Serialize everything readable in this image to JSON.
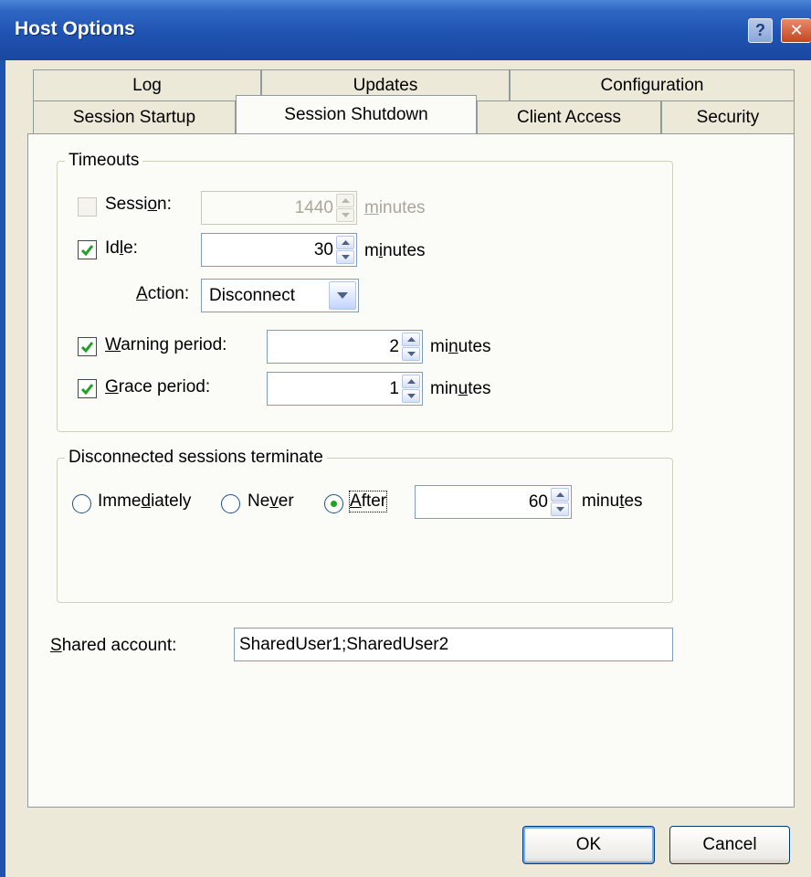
{
  "window": {
    "title": "Host Options",
    "help_glyph": "?",
    "close_glyph": "✕"
  },
  "tabs": {
    "row_top": [
      "Log",
      "Updates",
      "Configuration"
    ],
    "row_bottom": [
      "Session Startup",
      "Session Shutdown",
      "Client Access",
      "Security"
    ],
    "selected": "Session Shutdown"
  },
  "timeouts": {
    "group_label": "Timeouts",
    "session": {
      "label_pre": "Sessi",
      "label_mn": "o",
      "label_post": "n:",
      "checked": false,
      "value": "1440",
      "unit_pre": "",
      "unit_mn": "m",
      "unit_post": "inutes",
      "enabled": false
    },
    "idle": {
      "label_pre": "Id",
      "label_mn": "l",
      "label_post": "e:",
      "checked": true,
      "value": "30",
      "unit_pre": "m",
      "unit_mn": "i",
      "unit_post": "nutes",
      "enabled": true
    },
    "action": {
      "label_pre": "",
      "label_mn": "A",
      "label_post": "ction:",
      "value": "Disconnect"
    },
    "warning": {
      "label_pre": "",
      "label_mn": "W",
      "label_post": "arning period:",
      "checked": true,
      "value": "2",
      "unit_pre": "mi",
      "unit_mn": "n",
      "unit_post": "utes"
    },
    "grace": {
      "label_pre": "",
      "label_mn": "G",
      "label_post": "race period:",
      "checked": true,
      "value": "1",
      "unit_pre": "min",
      "unit_mn": "u",
      "unit_post": "tes"
    }
  },
  "disconnected": {
    "group_label": "Disconnected sessions terminate",
    "immediately": {
      "label_pre": "Imme",
      "label_mn": "d",
      "label_post": "iately",
      "selected": false
    },
    "never": {
      "label_pre": "Ne",
      "label_mn": "v",
      "label_post": "er",
      "selected": false
    },
    "after": {
      "label_pre": "",
      "label_mn": "A",
      "label_post": "fter",
      "selected": true
    },
    "value": "60",
    "unit_pre": "minu",
    "unit_mn": "t",
    "unit_post": "es"
  },
  "shared_account": {
    "label_pre": "",
    "label_mn": "S",
    "label_post": "hared account:",
    "value": "SharedUser1;SharedUser2"
  },
  "buttons": {
    "ok": "OK",
    "cancel": "Cancel"
  },
  "colors": {
    "titlebar": "#1f53b2",
    "dialog_bg": "#ece9d8",
    "panel_bg": "#fbfbf8",
    "checkmark": "#21a121"
  }
}
